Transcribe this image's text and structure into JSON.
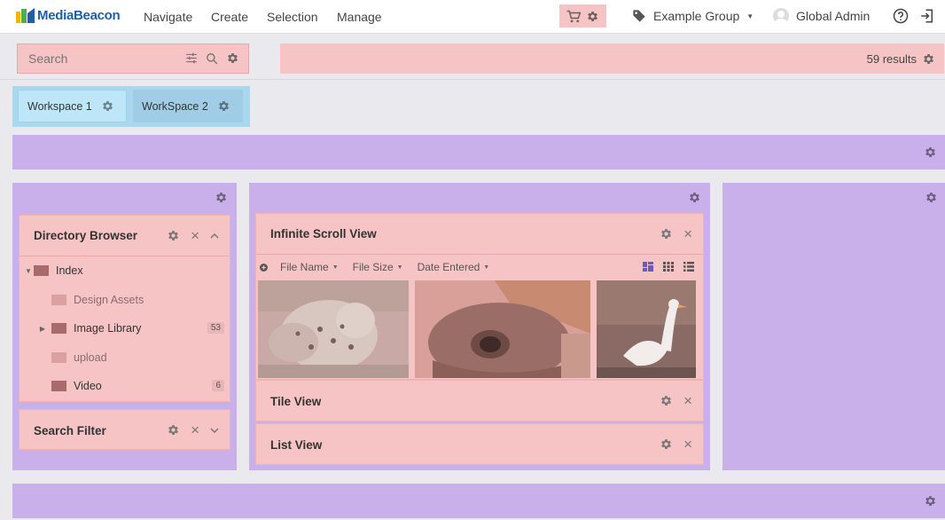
{
  "nav": {
    "logo_text": "MediaBeacon",
    "menus": [
      "Navigate",
      "Create",
      "Selection",
      "Manage"
    ],
    "group_label": "Example Group",
    "user_label": "Global Admin"
  },
  "search": {
    "placeholder": "Search",
    "results_text": "59 results"
  },
  "workspaces": [
    "Workspace 1",
    "WorkSpace 2"
  ],
  "directory_browser": {
    "title": "Directory Browser",
    "items": [
      {
        "label": "Index",
        "count": ""
      },
      {
        "label": "Design Assets",
        "count": ""
      },
      {
        "label": "Image Library",
        "count": "53"
      },
      {
        "label": "upload",
        "count": ""
      },
      {
        "label": "Video",
        "count": "6"
      }
    ]
  },
  "search_filter": {
    "title": "Search Filter"
  },
  "infinite_scroll": {
    "title": "Infinite Scroll View",
    "sort_fields": [
      "File Name",
      "File Size",
      "Date Entered"
    ]
  },
  "tile_view": {
    "title": "Tile View"
  },
  "list_view": {
    "title": "List View"
  },
  "colors": {
    "widget_bg": "#f6c4c4",
    "band_purple": "#c9b0eb",
    "workspace_blue": "#a9d7ee",
    "brand_blue": "#1f5fa8",
    "view_icon_active": "#6a5ac8"
  },
  "icons": {
    "settings": "gear-icon",
    "cart": "cart-icon",
    "tag": "tag-icon",
    "help": "help-circle-icon",
    "logout": "logout-icon",
    "filter": "sliders-icon",
    "search": "magnifier-icon"
  }
}
